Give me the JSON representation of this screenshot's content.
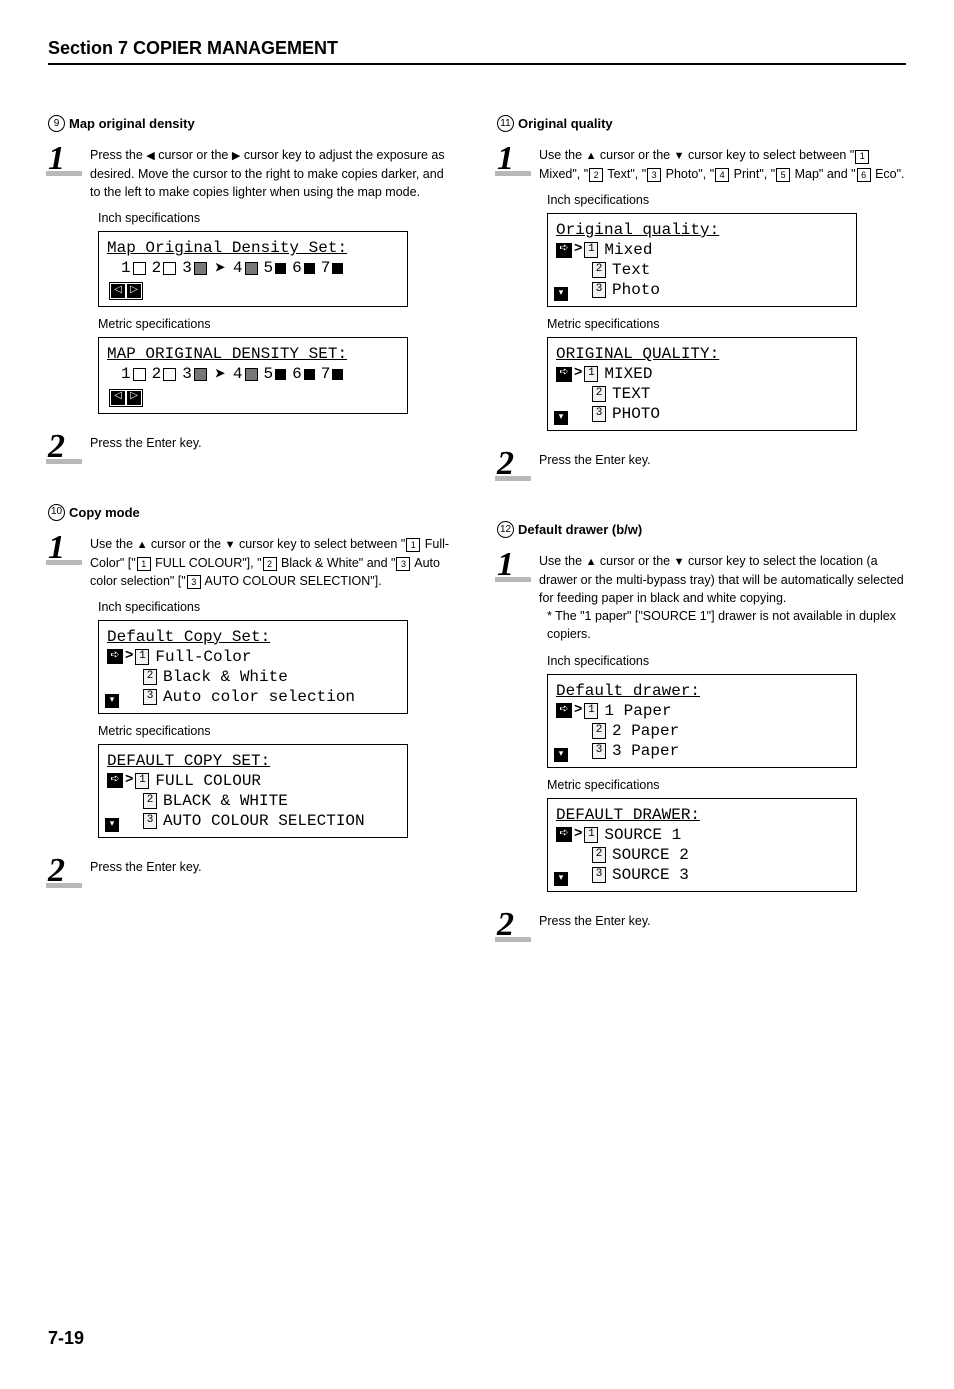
{
  "section_title": "Section 7  COPIER MANAGEMENT",
  "page_number": "7-19",
  "left": {
    "item9": {
      "num": "9",
      "title": "Map original density",
      "step1": {
        "num": "1",
        "t1": "Press the ",
        "t2": " cursor or the ",
        "t3": " cursor key to adjust the exposure as desired. Move the cursor to the right to make copies darker, and to the left to make copies lighter when using the map mode."
      },
      "spec_inch_label": "Inch specifications",
      "lcd_inch_title": "Map Original Density Set:",
      "spec_metric_label": "Metric specifications",
      "lcd_metric_title": "MAP ORIGINAL DENSITY SET:",
      "density_levels": [
        "1",
        "2",
        "3",
        "4",
        "5",
        "6",
        "7"
      ],
      "step2": {
        "num": "2",
        "text": "Press the Enter key."
      }
    },
    "item10": {
      "num": "10",
      "title": "Copy mode",
      "step1": {
        "num": "1",
        "t1": "Use the ",
        "t2": " cursor or the ",
        "t3": " cursor key to select between \"",
        "opt1a": "1",
        "opt1b": " Full-Color\" [\"",
        "opt1c": "1",
        "opt1d": " FULL COLOUR\"], \"",
        "opt2a": "2",
        "opt2b": " Black & White\" and \"",
        "opt3a": "3",
        "opt3b": " Auto color selection\" [\"",
        "opt3c": "3",
        "opt3d": " AUTO COLOUR SELECTION\"]."
      },
      "spec_inch_label": "Inch specifications",
      "lcd_inch": {
        "title": "Default Copy Set:",
        "o1": "Full-Color",
        "o2": "Black & White",
        "o3": "Auto color selection"
      },
      "spec_metric_label": "Metric specifications",
      "lcd_metric": {
        "title": "DEFAULT COPY SET:",
        "o1": "FULL COLOUR",
        "o2": "BLACK & WHITE",
        "o3": "AUTO COLOUR SELECTION"
      },
      "step2": {
        "num": "2",
        "text": "Press the Enter key."
      }
    }
  },
  "right": {
    "item11": {
      "num": "11",
      "title": "Original quality",
      "step1": {
        "num": "1",
        "t1": "Use the ",
        "t2": " cursor or the ",
        "t3": " cursor key to select between \"",
        "o1": "1",
        "o1t": " Mixed\", \"",
        "o2": "2",
        "o2t": " Text\", \"",
        "o3": "3",
        "o3t": " Photo\", \"",
        "o4": "4",
        "o4t": " Print\", \"",
        "o5": "5",
        "o5t": " Map\" and \"",
        "o6": "6",
        "o6t": " Eco\"."
      },
      "spec_inch_label": "Inch specifications",
      "lcd_inch": {
        "title": "Original quality:",
        "o1": "Mixed",
        "o2": "Text",
        "o3": "Photo"
      },
      "spec_metric_label": "Metric specifications",
      "lcd_metric": {
        "title": "ORIGINAL QUALITY:",
        "o1": "MIXED",
        "o2": "TEXT",
        "o3": "PHOTO"
      },
      "step2": {
        "num": "2",
        "text": "Press the Enter key."
      }
    },
    "item12": {
      "num": "12",
      "title": "Default drawer (b/w)",
      "step1": {
        "num": "1",
        "t1": "Use the ",
        "t2": " cursor or the ",
        "t3": " cursor key to select the location (a drawer or the multi-bypass tray) that will be automatically selected for feeding paper in black and white copying.",
        "note": "* The \"1 paper\" [\"SOURCE 1\"] drawer is not available in duplex copiers."
      },
      "spec_inch_label": "Inch specifications",
      "lcd_inch": {
        "title": "Default drawer:",
        "o1": "1 Paper",
        "o2": "2 Paper",
        "o3": "3 Paper"
      },
      "spec_metric_label": "Metric specifications",
      "lcd_metric": {
        "title": "DEFAULT DRAWER:",
        "o1": "SOURCE 1",
        "o2": "SOURCE 2",
        "o3": "SOURCE 3"
      },
      "step2": {
        "num": "2",
        "text": "Press the Enter key."
      }
    }
  }
}
